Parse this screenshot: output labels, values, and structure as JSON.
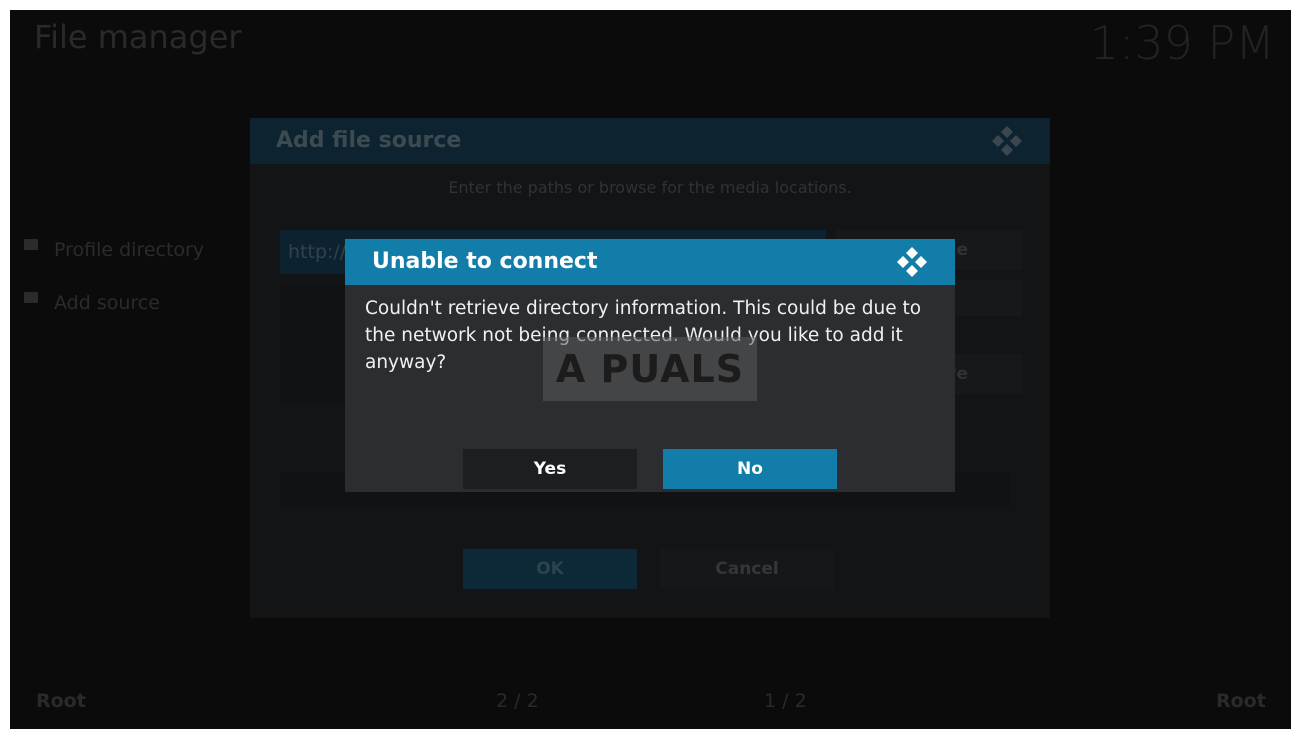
{
  "window": {
    "title": "File manager",
    "clock": "1:39 PM"
  },
  "sidebar": {
    "items": [
      {
        "label": "Profile directory",
        "icon": "folder-icon"
      },
      {
        "label": "Add source",
        "icon": "folder-icon"
      }
    ]
  },
  "footer": {
    "left_label": "Root",
    "left_page": "2 / 2",
    "right_page": "1 / 2",
    "right_label": "Root"
  },
  "add_source_dialog": {
    "title": "Add file source",
    "instructions": "Enter the paths or browse for the media locations.",
    "path_value": "http://",
    "browse_partial": "e",
    "remove_partial": "ve",
    "ok_label": "OK",
    "cancel_label": "Cancel"
  },
  "modal": {
    "title": "Unable to connect",
    "message": "Couldn't retrieve directory information. This could be due to the network not being connected. Would you like to add it anyway?",
    "yes_label": "Yes",
    "no_label": "No",
    "accent_color": "#127da8"
  },
  "watermark": {
    "text": "A PUALS"
  }
}
